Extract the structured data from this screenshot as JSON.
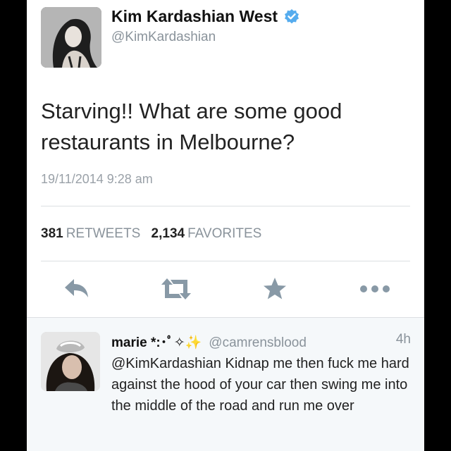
{
  "tweet": {
    "author_name": "Kim Kardashian West",
    "author_handle": "@KimKardashian",
    "text": "Starving!! What are some good restaurants in Melbourne?",
    "timestamp": "19/11/2014 9:28 am",
    "retweets_count": "381",
    "retweets_label": "RETWEETS",
    "favorites_count": "2,134",
    "favorites_label": "FAVORITES"
  },
  "actions": {
    "icons": [
      "reply-icon",
      "retweet-icon",
      "favorite-star-icon",
      "more-dots-icon"
    ]
  },
  "reply": {
    "author_name": "marie *:･ﾟ✧✨",
    "author_handle": "@camrensblood",
    "time": "4h",
    "text": "@KimKardashian Kidnap me then fuck me hard against the hood of your car then swing me into the middle of the road and run me over"
  },
  "colors": {
    "verified_badge": "#55acee",
    "icon_gray": "#8899a6",
    "muted_text": "#8a939b"
  }
}
